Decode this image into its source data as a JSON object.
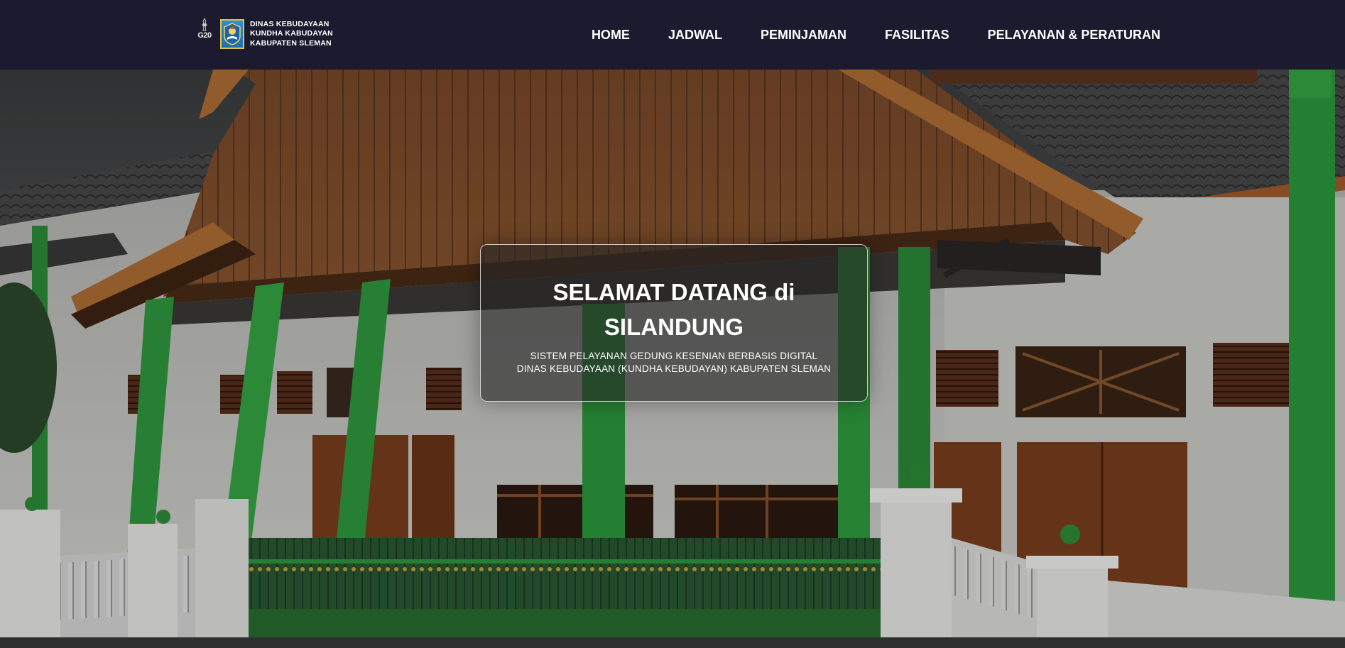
{
  "header": {
    "logo_text": "G20",
    "brand_lines": [
      "DINAS KEBUDAYAAN",
      "KUNDHA KABUDAYAN",
      "KABUPATEN SLEMAN"
    ],
    "nav": [
      {
        "label": "HOME"
      },
      {
        "label": "JADWAL"
      },
      {
        "label": "PEMINJAMAN"
      },
      {
        "label": "FASILITAS"
      },
      {
        "label": "PELAYANAN & PERATURAN"
      }
    ]
  },
  "hero": {
    "title_line1": "SELAMAT DATANG di",
    "title_line2": "SILANDUNG",
    "subtitle_line1": "SISTEM PELAYANAN GEDUNG KESENIAN BERBASIS DIGITAL",
    "subtitle_line2": "DINAS KEBUDAYAAN (KUNDHA KEBUDAYAN) KABUPATEN SLEMAN"
  },
  "colors": {
    "navbar_bg": "#1b1a2e",
    "roof_wood": "#7a4a2a",
    "pillar_green": "#2e9b3e",
    "wall_white": "#d6d6d2"
  },
  "icons": [
    "g20-logo-icon",
    "sleman-emblem-icon"
  ]
}
